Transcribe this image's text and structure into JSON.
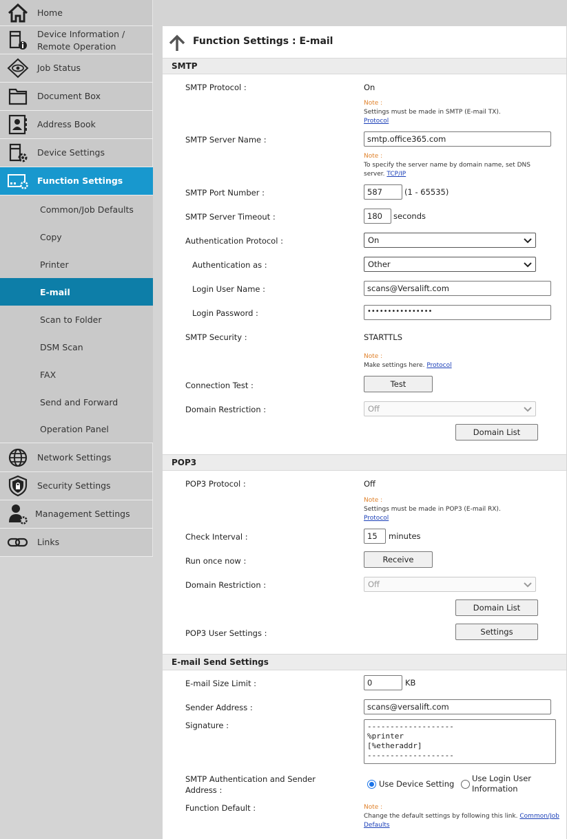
{
  "sidebar": {
    "items": [
      {
        "label": "Home",
        "icon": "home-icon"
      },
      {
        "label": "Device Information /",
        "label2": "Remote Operation",
        "icon": "device-info-icon"
      },
      {
        "label": "Job Status",
        "icon": "eye-icon"
      },
      {
        "label": "Document Box",
        "icon": "folder-icon"
      },
      {
        "label": "Address Book",
        "icon": "address-book-icon"
      },
      {
        "label": "Device Settings",
        "icon": "device-settings-icon"
      },
      {
        "label": "Function Settings",
        "icon": "function-settings-icon"
      },
      {
        "label": "Network Settings",
        "icon": "globe-icon"
      },
      {
        "label": "Security Settings",
        "icon": "shield-icon"
      },
      {
        "label": "Management Settings",
        "icon": "user-gear-icon"
      },
      {
        "label": "Links",
        "icon": "link-icon"
      }
    ],
    "sub_items": [
      "Common/Job Defaults",
      "Copy",
      "Printer",
      "E-mail",
      "Scan to Folder",
      "DSM Scan",
      "FAX",
      "Send and Forward",
      "Operation Panel"
    ],
    "active_color": "#1898ce",
    "active_sub_color": "#0d7ea8"
  },
  "page": {
    "title": "Function Settings : E-mail"
  },
  "smtp": {
    "header": "SMTP",
    "protocol_label": "SMTP Protocol :",
    "protocol_value": "On",
    "protocol_note_tag": "Note :",
    "protocol_note": "Settings must be made in SMTP (E-mail TX).",
    "protocol_note_link": "Protocol",
    "server_name_label": "SMTP Server Name :",
    "server_name_value": "smtp.office365.com",
    "server_note_tag": "Note :",
    "server_note_1": "To specify the server name by domain name, set DNS",
    "server_note_2": "server.",
    "server_note_link": "TCP/IP",
    "port_label": "SMTP Port Number :",
    "port_value": "587",
    "port_range": "(1 - 65535)",
    "timeout_label": "SMTP Server Timeout :",
    "timeout_value": "180",
    "timeout_unit": "seconds",
    "auth_protocol_label": "Authentication Protocol :",
    "auth_protocol_value": "On",
    "auth_as_label": "Authentication as :",
    "auth_as_value": "Other",
    "login_user_label": "Login User Name :",
    "login_user_value": "scans@Versalift.com",
    "login_password_label": "Login Password :",
    "login_password_value": "••••••••••••••••",
    "security_label": "SMTP Security :",
    "security_value": "STARTTLS",
    "security_note_tag": "Note :",
    "security_note": "Make settings here.",
    "security_note_link": "Protocol",
    "conn_test_label": "Connection Test :",
    "test_button": "Test",
    "domain_restriction_label": "Domain Restriction :",
    "domain_restriction_value": "Off",
    "domain_list_button": "Domain List"
  },
  "pop3": {
    "header": "POP3",
    "protocol_label": "POP3 Protocol :",
    "protocol_value": "Off",
    "note_tag": "Note :",
    "note": "Settings must be made in POP3 (E-mail RX).",
    "note_link": "Protocol",
    "interval_label": "Check Interval :",
    "interval_value": "15",
    "interval_unit": "minutes",
    "run_once_label": "Run once now :",
    "receive_button": "Receive",
    "domain_restriction_label": "Domain Restriction :",
    "domain_restriction_value": "Off",
    "domain_list_button": "Domain List",
    "user_settings_label": "POP3 User Settings :",
    "settings_button": "Settings"
  },
  "send": {
    "header": "E-mail Send Settings",
    "size_limit_label": "E-mail Size Limit :",
    "size_limit_value": "0",
    "size_limit_unit": "KB",
    "sender_label": "Sender Address :",
    "sender_value": "scans@versalift.com",
    "signature_label": "Signature :",
    "signature_value": "-------------------\n%printer\n[%etheraddr]\n-------------------",
    "smtp_auth_label_1": "SMTP Authentication and Sender",
    "smtp_auth_label_2": "Address :",
    "radio_device": "Use Device Setting",
    "radio_login_1": "Use Login User",
    "radio_login_2": "Information",
    "function_default_label": "Function Default :",
    "fd_note_tag": "Note :",
    "fd_note": "Change the default settings by following this link.",
    "fd_note_link_1": "Common/Job",
    "fd_note_link_2": "Defaults"
  }
}
